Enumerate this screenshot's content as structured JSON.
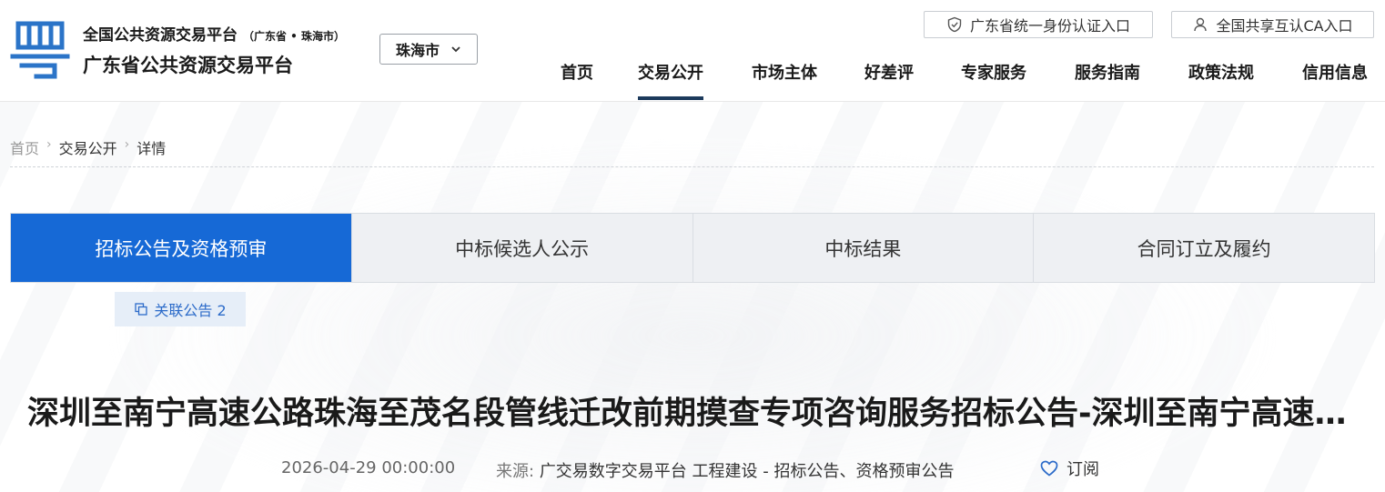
{
  "header": {
    "site_name_1": "全国公共资源交易平台",
    "site_name_1_sub": "（广东省 • 珠海市）",
    "site_name_2": "广东省公共资源交易平台",
    "city": "珠海市",
    "link_gd": "广东省统一身份认证入口",
    "link_ca": "全国共享互认CA入口"
  },
  "nav": {
    "items": [
      "首页",
      "交易公开",
      "市场主体",
      "好差评",
      "专家服务",
      "服务指南",
      "政策法规",
      "信用信息"
    ],
    "active": "交易公开"
  },
  "breadcrumb": {
    "home": "首页",
    "mid": "交易公开",
    "current": "详情"
  },
  "tabs": [
    "招标公告及资格预审",
    "中标候选人公示",
    "中标结果",
    "合同订立及履约"
  ],
  "related_label": "关联公告 2",
  "article": {
    "title": "深圳至南宁高速公路珠海至茂名段管线迁改前期摸查专项咨询服务招标公告-深圳至南宁高速公路珠海至茂名段管线迁改前期摸查专项咨询服务",
    "date": "2026-04-29 00:00:00",
    "source_label": "来源:",
    "source_value": "广交易数字交易平台 工程建设 - 招标公告、资格预审公告",
    "subscribe": "订阅"
  },
  "colors": {
    "accent": "#1669d6",
    "nav_underline": "#1c3a5c",
    "logo": "#2b74c8"
  }
}
